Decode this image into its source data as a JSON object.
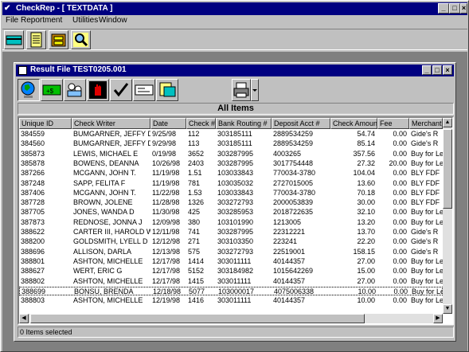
{
  "app": {
    "title": "CheckRep - [ TEXTDATA ]",
    "menu": [
      "File",
      "Reportment",
      "Utilities",
      "Window"
    ]
  },
  "child": {
    "title": "Result File TEST0205.001",
    "banner": "All Items",
    "status": "0 Items selected"
  },
  "table": {
    "columns": [
      "Unique ID",
      "Check Writer",
      "Date",
      "Check #",
      "Bank Routing #",
      "Deposit Acct #",
      "Check Amount",
      "Fee",
      "Merchant"
    ],
    "rows": [
      [
        "384559",
        "BUMGARNER, JEFFY D.",
        "9/25/98",
        "112",
        "303185111",
        "2889534259",
        "54.74",
        "0.00",
        "Gide's R"
      ],
      [
        "384560",
        "BUMGARNER, JEFFY D.",
        "9/29/98",
        "113",
        "303185111",
        "2889534259",
        "85.14",
        "0.00",
        "Gide's R"
      ],
      [
        "385873",
        "LEWIS, MICHAEL E",
        "0/19/98",
        "3652",
        "303287995",
        "4003265",
        "357.56",
        "0.00",
        "Buy for Le"
      ],
      [
        "385878",
        "BOWENS, DEANNA",
        "10/26/98",
        "2403",
        "303287995",
        "3017754448",
        "27.32",
        "20.00",
        "Buy for Le"
      ],
      [
        "387266",
        "MCGANN, JOHN T.",
        "11/19/98",
        "1.51",
        "103033843",
        "770034-3780",
        "104.04",
        "0.00",
        "BLY FDF"
      ],
      [
        "387248",
        "SAPP, FELITA F",
        "11/19/98",
        "781",
        "103035032",
        "2727015005",
        "13.60",
        "0.00",
        "BLY FDF"
      ],
      [
        "387406",
        "MCGANN, JOHN T.",
        "11/22/98",
        "1.53",
        "103033843",
        "770034-3780",
        "70.18",
        "0.00",
        "BLY FDF"
      ],
      [
        "387728",
        "BROWN, JOLENE",
        "11/28/98",
        "1326",
        "303272793",
        "2000053839",
        "30.00",
        "0.00",
        "BLY FDF"
      ],
      [
        "387705",
        "JONES, WANDA D",
        "11/30/98",
        "425",
        "303285953",
        "2018722635",
        "32.10",
        "0.00",
        "Buy for Le"
      ],
      [
        "387873",
        "REDNOSE, JONNA J",
        "12/09/98",
        "380",
        "103101990",
        "1213005",
        "13.20",
        "0.00",
        "Buy for Le"
      ],
      [
        "388622",
        "CARTER III, HAROLD W.",
        "12/11/98",
        "741",
        "303287995",
        "22312221",
        "13.70",
        "0.00",
        "Gide's R"
      ],
      [
        "388200",
        "GOLDSMITH, LYELL D",
        "12/12/98",
        "271",
        "303103350",
        "223241",
        "22.20",
        "0.00",
        "Gide's R"
      ],
      [
        "388696",
        "ALLISON, DARLA",
        "12/13/98",
        "575",
        "303272793",
        "22519001",
        "158.15",
        "0.00",
        "Gide's R"
      ],
      [
        "388801",
        "ASHTON, MICHELLE",
        "12/17/98",
        "1414",
        "303011111",
        "40144357",
        "27.00",
        "0.00",
        "Buy for Le"
      ],
      [
        "388627",
        "WERT, ERIC G",
        "12/17/98",
        "5152",
        "303184982",
        "1015642269",
        "15.00",
        "0.00",
        "Buy for Le"
      ],
      [
        "388802",
        "ASHTON, MICHELLE",
        "12/17/98",
        "1415",
        "303011111",
        "40144357",
        "27.00",
        "0.00",
        "Buy for Le"
      ],
      [
        "388699",
        "BONSU, BRENDA",
        "12/18/98",
        "5077",
        "103000017",
        "4075006338",
        "10.00",
        "0.00",
        "Buy for Le"
      ],
      [
        "388803",
        "ASHTON, MICHELLE",
        "12/19/98",
        "1416",
        "303011111",
        "40144357",
        "10.00",
        "0.00",
        "Buy for Le"
      ]
    ]
  },
  "colors": {
    "titlebar": "#000080",
    "face": "#c0c0c0",
    "desktop": "#808080"
  }
}
